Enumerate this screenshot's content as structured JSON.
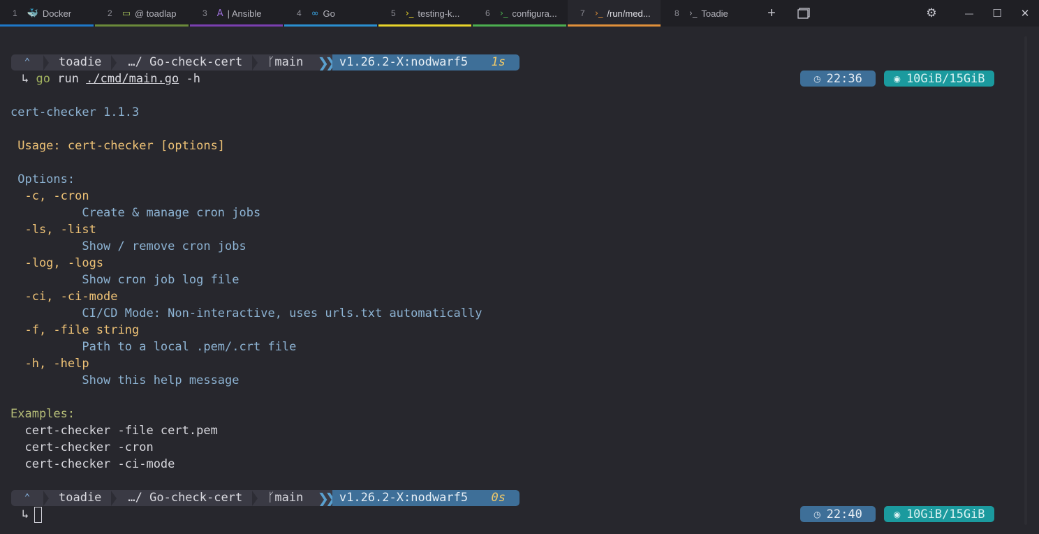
{
  "tabs": [
    {
      "num": "1",
      "icon": "docker-icon",
      "glyph": "🐳",
      "label": "Docker",
      "bar": "#1e78c8",
      "active": false
    },
    {
      "num": "2",
      "icon": "monitor-icon",
      "glyph": "▭",
      "label": "@ toadlap",
      "bar": "#6b8a3a",
      "active": false
    },
    {
      "num": "3",
      "icon": "ansible-icon",
      "glyph": "A",
      "label": "| Ansible",
      "bar": "#7a3fb0",
      "active": false
    },
    {
      "num": "4",
      "icon": "go-icon",
      "glyph": "∞",
      "label": "Go",
      "bar": "#2a8fd0",
      "active": false
    },
    {
      "num": "5",
      "icon": "terminal-icon",
      "glyph": "›_",
      "label": "testing-k...",
      "bar": "#e8d42a",
      "active": false
    },
    {
      "num": "6",
      "icon": "terminal-icon",
      "glyph": "›_",
      "label": "configura...",
      "bar": "#4caf50",
      "active": false
    },
    {
      "num": "7",
      "icon": "terminal-icon",
      "glyph": "›_",
      "label": "/run/med...",
      "bar": "#e0903a",
      "active": true
    },
    {
      "num": "8",
      "icon": "terminal-icon",
      "glyph": "›_",
      "label": "Toadie",
      "bar": "",
      "active": false
    }
  ],
  "titlebar": {
    "new_tab": "+",
    "settings": "⚙",
    "minimize": "—",
    "maximize": "☐",
    "close": "✕"
  },
  "prompt1": {
    "os": "⌃",
    "user": "toadie",
    "path": "…/ Go-check-cert",
    "branch_icon": "ᚴ",
    "branch": "main",
    "go_version": "v1.26.2-X:nodwarf5",
    "duration": "1s",
    "time": "22:36",
    "memory": "10GiB/15GiB"
  },
  "command": {
    "arrow": "↳",
    "go": "go",
    "run": " run ",
    "path": "./cmd/main.go",
    "flag": " -h"
  },
  "output": {
    "title": "cert-checker 1.1.3",
    "usage": " Usage: cert-checker [options]",
    "options_header": " Options:",
    "options": [
      {
        "flag": "  -c, -cron",
        "desc": "          Create & manage cron jobs"
      },
      {
        "flag": "  -ls, -list",
        "desc": "          Show / remove cron jobs"
      },
      {
        "flag": "  -log, -logs",
        "desc": "          Show cron job log file"
      },
      {
        "flag": "  -ci, -ci-mode",
        "desc": "          CI/CD Mode: Non-interactive, uses urls.txt automatically"
      },
      {
        "flag": "  -f, -file string",
        "desc": "          Path to a local .pem/.crt file"
      },
      {
        "flag": "  -h, -help",
        "desc": "          Show this help message"
      }
    ],
    "examples_header": "Examples:",
    "examples": [
      "  cert-checker -file cert.pem",
      "  cert-checker -cron",
      "  cert-checker -ci-mode"
    ]
  },
  "prompt2": {
    "os": "⌃",
    "user": "toadie",
    "path": "…/ Go-check-cert",
    "branch_icon": "ᚴ",
    "branch": "main",
    "go_version": "v1.26.2-X:nodwarf5",
    "duration": "0s",
    "time": "22:40",
    "memory": "10GiB/15GiB"
  },
  "input": {
    "arrow": "↳"
  }
}
